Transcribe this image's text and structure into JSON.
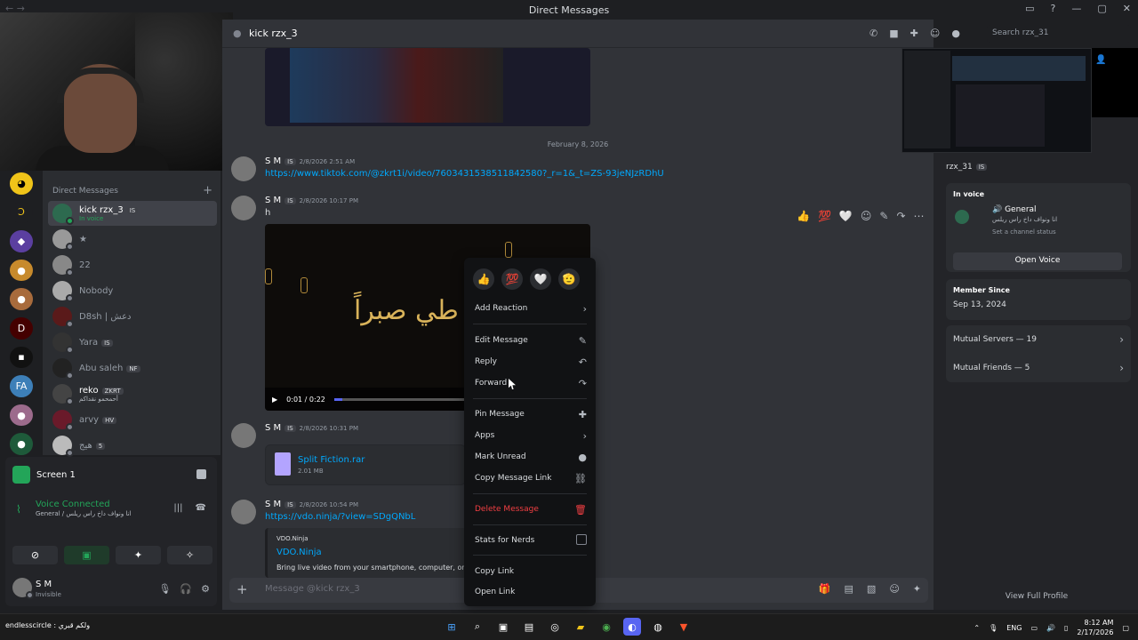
{
  "window": {
    "title": "Direct Messages"
  },
  "dm_sidebar": {
    "header": "Direct Messages",
    "items": [
      {
        "name": "kick rzx_3",
        "badge": "IS",
        "sub": "In voice",
        "active": true
      },
      {
        "name": "★"
      },
      {
        "name": "22"
      },
      {
        "name": "Nobody"
      },
      {
        "name": "D8sh | دعش"
      },
      {
        "name": "Yara",
        "badge": "IS"
      },
      {
        "name": "Abu saleh",
        "badge": "NF"
      },
      {
        "name": "reko",
        "badge": "ZKRT",
        "sub": "أحمحمو نقداكم"
      },
      {
        "name": "arvy",
        "badge": "HV"
      },
      {
        "name": "هيج",
        "badge": "5"
      }
    ]
  },
  "screen_panel": {
    "title": "Screen 1",
    "voice_status": "Voice Connected",
    "channel": "General / انا ونواف داخ راس ريلس"
  },
  "user": {
    "name": "S M",
    "status": "Invisible"
  },
  "chat": {
    "recipient": "kick rzx_3",
    "search_placeholder": "Search rzx_31",
    "date_divider": "February 8, 2026",
    "messages": [
      {
        "author": "S M",
        "badge": "IS",
        "time": "2/8/2026 2:51 AM",
        "text": "https://www.tiktok.com/@zkrt1i/video/7603431538511842580?_r=1&_t=ZS-93jeNJzRDhU"
      },
      {
        "author": "S M",
        "badge": "IS",
        "time": "2/8/2026 10:17 PM",
        "text": "h"
      },
      {
        "author": "S M",
        "badge": "IS",
        "time": "2/8/2026 10:31 PM"
      },
      {
        "author": "S M",
        "badge": "IS",
        "time": "2/8/2026 10:54 PM",
        "text": "https://vdo.ninja/?view=SDgQNbL"
      }
    ],
    "video": {
      "time": "0:01 / 0:22",
      "overlay_text": "طي صبراً",
      "progress": 0.05
    },
    "file": {
      "name": "Split Fiction.rar",
      "size": "2.01 MB"
    },
    "embed": {
      "provider": "VDO.Ninja",
      "title": "VDO.Ninja",
      "desc": "Bring live video from your smartphone, computer, or fr"
    },
    "composer_placeholder": "Message @kick rzx_3"
  },
  "context_menu": {
    "quick_reactions": [
      "👍",
      "💯",
      "🤍",
      "🫡"
    ],
    "items": [
      {
        "label": "Add Reaction",
        "icon": "chevron-right-icon"
      },
      {
        "label": "Edit Message",
        "icon": "pencil-icon"
      },
      {
        "label": "Reply",
        "icon": "reply-icon"
      },
      {
        "label": "Forward",
        "icon": "forward-icon"
      },
      {
        "label": "Pin Message",
        "icon": "pin-icon"
      },
      {
        "label": "Apps",
        "icon": "chevron-right-icon"
      },
      {
        "label": "Mark Unread",
        "icon": "mark-unread-icon"
      },
      {
        "label": "Copy Message Link",
        "icon": "link-icon"
      },
      {
        "label": "Delete Message",
        "icon": "trash-icon",
        "danger": true
      },
      {
        "label": "Stats for Nerds",
        "icon": "checkbox-icon"
      },
      {
        "label": "Copy Link"
      },
      {
        "label": "Open Link"
      }
    ]
  },
  "profile": {
    "username": "rzx_31",
    "badge": "IS",
    "in_voice_label": "In voice",
    "voice_channel": "General",
    "voice_sub": "انا ونواف داخ راس ريلس",
    "set_status": "Set a channel status",
    "open_voice": "Open Voice",
    "member_since_label": "Member Since",
    "member_since": "Sep 13, 2024",
    "mutual_servers": "Mutual Servers — 19",
    "mutual_friends": "Mutual Friends — 5",
    "view_full": "View Full Profile"
  },
  "taskbar": {
    "stream_label": "endlesscircle : ولكم قبري",
    "lang": "ENG",
    "time": "8:12 AM",
    "date": "2/17/2026"
  }
}
